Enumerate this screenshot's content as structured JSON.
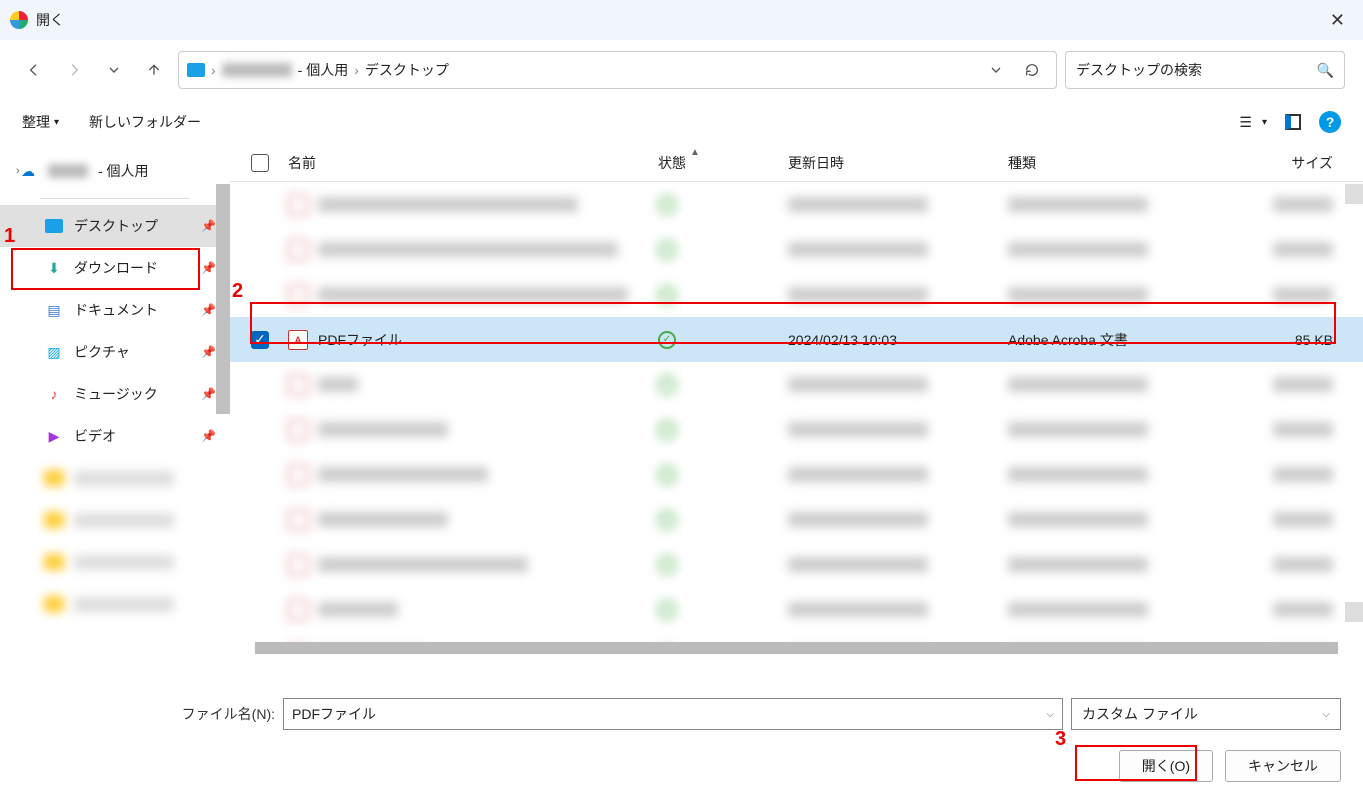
{
  "title": "開く",
  "breadcrumb": {
    "user_suffix": " - 個人用",
    "folder": "デスクトップ"
  },
  "search_placeholder": "デスクトップの検索",
  "toolbar": {
    "organize": "整理",
    "new_folder": "新しいフォルダー"
  },
  "sidebar": {
    "onedrive_suffix": " - 個人用",
    "desktop": "デスクトップ",
    "downloads": "ダウンロード",
    "documents": "ドキュメント",
    "pictures": "ピクチャ",
    "music": "ミュージック",
    "videos": "ビデオ"
  },
  "columns": {
    "name": "名前",
    "state": "状態",
    "date": "更新日時",
    "type": "種類",
    "size": "サイズ"
  },
  "selected_file": {
    "name": "PDFファイル",
    "date": "2024/02/13 10:03",
    "type": "Adobe Acroba 文書",
    "size": "85 KB"
  },
  "footer": {
    "filename_label": "ファイル名(N):",
    "filename_value": "PDFファイル",
    "filter": "カスタム ファイル",
    "open": "開く(O)",
    "cancel": "キャンセル"
  },
  "annot": {
    "1": "1",
    "2": "2",
    "3": "3"
  }
}
